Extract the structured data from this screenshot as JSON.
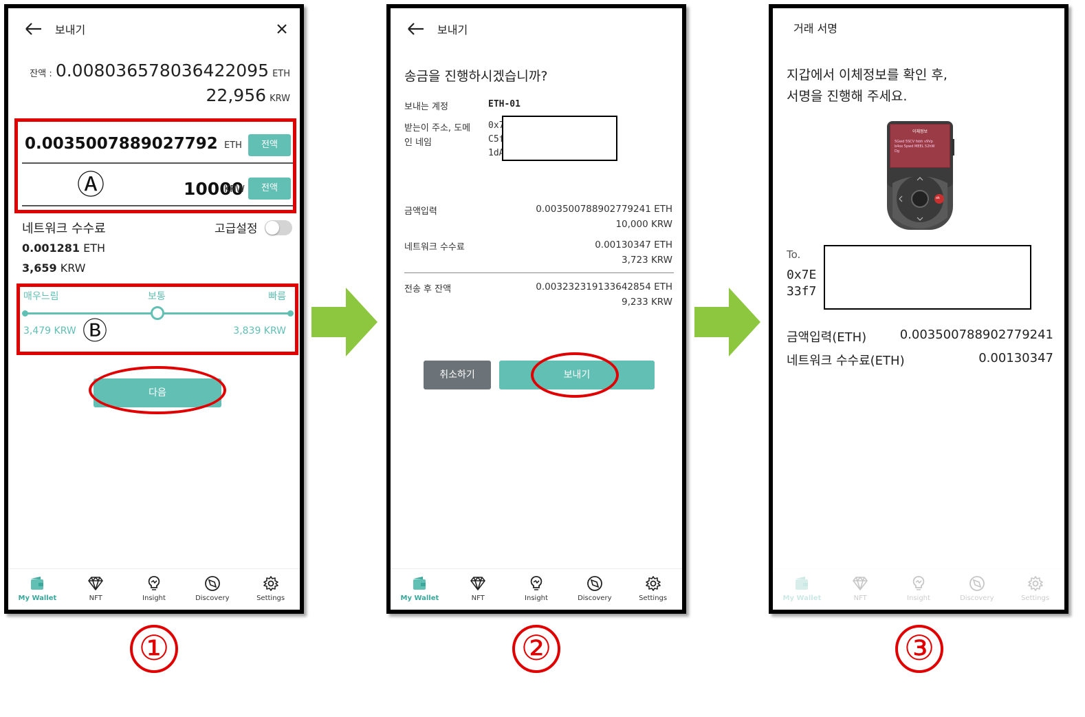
{
  "screen1": {
    "title": "보내기",
    "balance_label": "잔액 :",
    "balance_eth": "0.008036578036422095",
    "balance_eth_unit": "ETH",
    "balance_krw": "22,956",
    "balance_krw_unit": "KRW",
    "amount_eth": "0.0035007889027792411",
    "amount_eth_unit": "ETH",
    "max_label": "전액",
    "marker_a": "Ⓐ",
    "amount_krw": "10000",
    "amount_krw_unit": "KRW",
    "fee_label": "네트워크 수수료",
    "advanced_label": "고급설정",
    "fee_eth": "0.001281",
    "fee_eth_unit": "ETH",
    "fee_krw": "3,659",
    "fee_krw_unit": "KRW",
    "speed_slow": "매우느림",
    "speed_normal": "보통",
    "speed_fast": "빠름",
    "slow_krw": "3,479 KRW",
    "fast_krw": "3,839 KRW",
    "marker_b": "Ⓑ",
    "next_button": "다음"
  },
  "screen2": {
    "title": "보내기",
    "question": "송금을 진행하시겠습니까?",
    "from_label": "보내는 계정",
    "from_value": "ETH-01",
    "to_label_1": "받는이 주소, 도메",
    "to_label_2": "인 네임",
    "to_partial_1": "0x7",
    "to_partial_2": "C5f",
    "to_partial_3": "1dA",
    "amount_label": "금액입력",
    "amount_eth": "0.003500788902779241 ETH",
    "amount_krw": "10,000 KRW",
    "fee_label": "네트워크 수수료",
    "fee_eth": "0.00130347 ETH",
    "fee_krw": "3,723 KRW",
    "remain_label": "전송 후 잔액",
    "remain_eth": "0.003232319133642854 ETH",
    "remain_krw": "9,233 KRW",
    "cancel_button": "취소하기",
    "send_button": "보내기"
  },
  "screen3": {
    "title": "거래 서명",
    "instruction_1": "지갑에서 이체정보를 확인 후,",
    "instruction_2": "서명을 진행해 주세요.",
    "device_screen_title": "이체정보",
    "device_screen_text_1": "5Gwd 5SCV fsbh v9Vp",
    "device_screen_text_2": "b4ox 5pwd MEEL 52hW",
    "device_screen_text_3": "Dg",
    "device_ok": "ok",
    "to_label": "To.",
    "to_partial_1": "0x7E",
    "to_partial_2": "33f7",
    "amount_label": "금액입력(ETH)",
    "amount_value": "0.003500788902779241",
    "fee_label": "네트워크 수수료(ETH)",
    "fee_value": "0.00130347"
  },
  "nav": {
    "wallet": "My Wallet",
    "nft": "NFT",
    "insight": "Insight",
    "discovery": "Discovery",
    "settings": "Settings"
  },
  "steps": [
    "①",
    "②",
    "③"
  ],
  "colors": {
    "accent": "#62bfb4",
    "annotation": "#e00000",
    "arrow": "#8dc63f",
    "cancel": "#6b7378"
  }
}
